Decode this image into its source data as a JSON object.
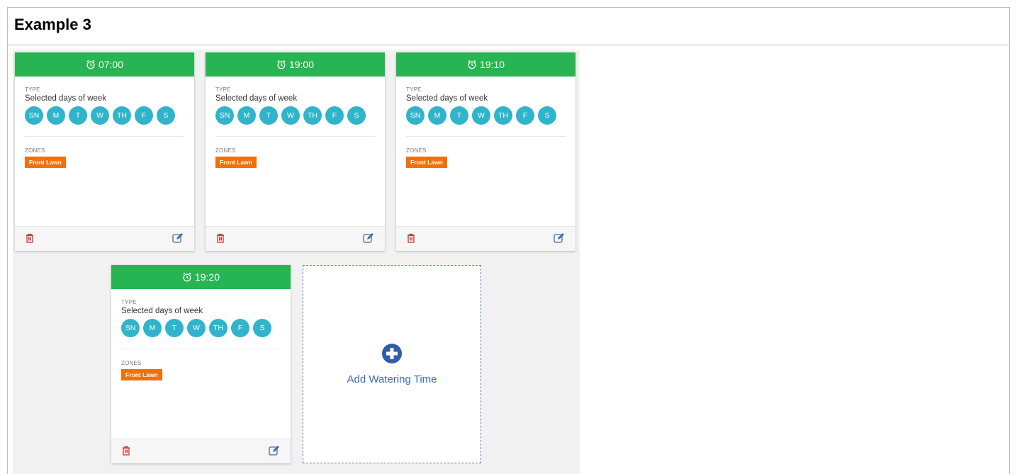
{
  "example_title": "Example 3",
  "labels": {
    "type": "TYPE",
    "zones": "ZONES"
  },
  "cards": [
    {
      "time": "07:00",
      "type_value": "Selected days of week",
      "days": [
        "SN",
        "M",
        "T",
        "W",
        "TH",
        "F",
        "S"
      ],
      "zones": [
        "Front Lawn"
      ]
    },
    {
      "time": "19:00",
      "type_value": "Selected days of week",
      "days": [
        "SN",
        "M",
        "T",
        "W",
        "TH",
        "F",
        "S"
      ],
      "zones": [
        "Front Lawn"
      ]
    },
    {
      "time": "19:10",
      "type_value": "Selected days of week",
      "days": [
        "SN",
        "M",
        "T",
        "W",
        "TH",
        "F",
        "S"
      ],
      "zones": [
        "Front Lawn"
      ]
    },
    {
      "time": "19:20",
      "type_value": "Selected days of week",
      "days": [
        "SN",
        "M",
        "T",
        "W",
        "TH",
        "F",
        "S"
      ],
      "zones": [
        "Front Lawn"
      ]
    }
  ],
  "add_card": {
    "label": "Add Watering Time"
  },
  "icons": {
    "header": "alarm-clock-icon",
    "delete": "trash-icon",
    "edit": "edit-icon",
    "add": "plus-circle-icon"
  },
  "colors": {
    "header_green": "#27b553",
    "day_teal": "#2fb4cc",
    "zone_orange": "#f27008",
    "delete_red": "#c0392b",
    "edit_blue": "#3a6cb3"
  }
}
